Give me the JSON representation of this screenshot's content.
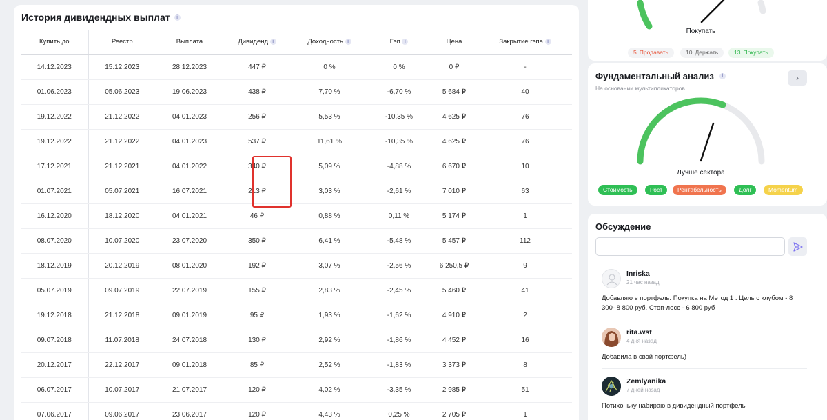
{
  "dividends": {
    "title": "История дивидендных выплат",
    "headers": [
      "Купить до",
      "Реестр",
      "Выплата",
      "Дивиденд",
      "Доходность",
      "Гэп",
      "Цена",
      "Закрытие гэпа"
    ],
    "rows": [
      [
        "14.12.2023",
        "15.12.2023",
        "28.12.2023",
        "447 ₽",
        "0 %",
        "0 %",
        "0 ₽",
        "-"
      ],
      [
        "01.06.2023",
        "05.06.2023",
        "19.06.2023",
        "438 ₽",
        "7,70 %",
        "-6,70 %",
        "5 684 ₽",
        "40"
      ],
      [
        "19.12.2022",
        "21.12.2022",
        "04.01.2023",
        "256 ₽",
        "5,53 %",
        "-10,35 %",
        "4 625 ₽",
        "76"
      ],
      [
        "19.12.2022",
        "21.12.2022",
        "04.01.2023",
        "537 ₽",
        "11,61 %",
        "-10,35 %",
        "4 625 ₽",
        "76"
      ],
      [
        "17.12.2021",
        "21.12.2021",
        "04.01.2022",
        "340 ₽",
        "5,09 %",
        "-4,88 %",
        "6 670 ₽",
        "10"
      ],
      [
        "01.07.2021",
        "05.07.2021",
        "16.07.2021",
        "213 ₽",
        "3,03 %",
        "-2,61 %",
        "7 010 ₽",
        "63"
      ],
      [
        "16.12.2020",
        "18.12.2020",
        "04.01.2021",
        "46 ₽",
        "0,88 %",
        "0,11 %",
        "5 174 ₽",
        "1"
      ],
      [
        "08.07.2020",
        "10.07.2020",
        "23.07.2020",
        "350 ₽",
        "6,41 %",
        "-5,48 %",
        "5 457 ₽",
        "112"
      ],
      [
        "18.12.2019",
        "20.12.2019",
        "08.01.2020",
        "192 ₽",
        "3,07 %",
        "-2,56 %",
        "6 250,5 ₽",
        "9"
      ],
      [
        "05.07.2019",
        "09.07.2019",
        "22.07.2019",
        "155 ₽",
        "2,83 %",
        "-2,45 %",
        "5 460 ₽",
        "41"
      ],
      [
        "19.12.2018",
        "21.12.2018",
        "09.01.2019",
        "95 ₽",
        "1,93 %",
        "-1,62 %",
        "4 910 ₽",
        "2"
      ],
      [
        "09.07.2018",
        "11.07.2018",
        "24.07.2018",
        "130 ₽",
        "2,92 %",
        "-1,86 %",
        "4 452 ₽",
        "16"
      ],
      [
        "20.12.2017",
        "22.12.2017",
        "09.01.2018",
        "85 ₽",
        "2,52 %",
        "-1,83 %",
        "3 373 ₽",
        "8"
      ],
      [
        "06.07.2017",
        "10.07.2017",
        "21.07.2017",
        "120 ₽",
        "4,02 %",
        "-3,35 %",
        "2 985 ₽",
        "51"
      ],
      [
        "07.06.2017",
        "09.06.2017",
        "23.06.2017",
        "120 ₽",
        "4,43 %",
        "0,25 %",
        "2 705 ₽",
        "1"
      ]
    ],
    "header_info_columns": [
      3,
      4,
      5,
      7
    ]
  },
  "analyst_rating": {
    "gauge_label": "Покупать",
    "sell": {
      "count": "5",
      "label": "Продавать"
    },
    "hold": {
      "count": "10",
      "label": "Держать"
    },
    "buy": {
      "count": "13",
      "label": "Покупать"
    }
  },
  "fundamental": {
    "title": "Фундаментальный анализ",
    "subtitle": "На основании мультипликаторов",
    "nav_glyph": "›",
    "gauge_label": "Лучше сектора",
    "tags": [
      {
        "label": "Стоимость",
        "color": "#2fbf55"
      },
      {
        "label": "Рост",
        "color": "#2fbf55"
      },
      {
        "label": "Рентабельность",
        "color": "#f0744e"
      },
      {
        "label": "Долг",
        "color": "#2fbf55"
      },
      {
        "label": "Momentum",
        "color": "#f5d24a"
      }
    ]
  },
  "discussion": {
    "title": "Обсуждение",
    "input_value": "",
    "comments": [
      {
        "user": "Inriska",
        "time": "21 час назад",
        "text": [
          "Добавляю в портфель. Покупка на Метод 1 . Цель с клубом - 8",
          "300- 8 800 руб. Стоп-лосс - 6 800 руб"
        ]
      },
      {
        "user": "rita.wst",
        "time": "4 дня назад",
        "text": [
          "Добавила в свой портфель)"
        ]
      },
      {
        "user": "Zemlyanika",
        "time": "7 дней назад",
        "text": [
          "Потихоньку набираю в дивидендный портфель"
        ]
      }
    ]
  }
}
